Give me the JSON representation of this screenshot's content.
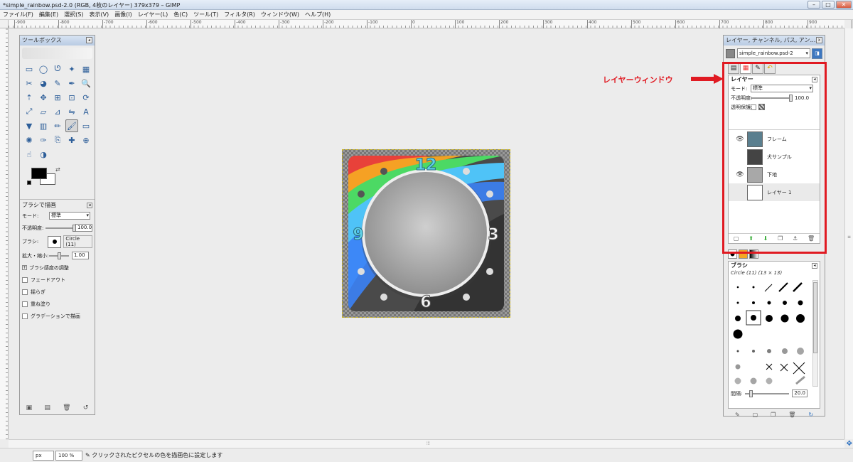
{
  "window": {
    "title": "*simple_rainbow.psd-2.0 (RGB, 4枚のレイヤー) 379x379 – GIMP"
  },
  "menu": [
    "ファイル(F)",
    "編集(E)",
    "選択(S)",
    "表示(V)",
    "画像(I)",
    "レイヤー(L)",
    "色(C)",
    "ツール(T)",
    "フィルタ(R)",
    "ウィンドウ(W)",
    "ヘルプ(H)"
  ],
  "ruler": {
    "ticks": [
      "-900",
      "-800",
      "-700",
      "-600",
      "-500",
      "-400",
      "-300",
      "-200",
      "-100",
      "0",
      "100",
      "200",
      "300",
      "400",
      "500",
      "600",
      "700",
      "800",
      "900",
      "1000"
    ]
  },
  "toolbox": {
    "title": "ツールボックス",
    "tools": [
      "rect-select-icon",
      "ellipse-select-icon",
      "lasso-icon",
      "fuzzy-select-icon",
      "select-by-color-icon",
      "scissors-icon",
      "foreground-select-icon",
      "paths-icon",
      "color-picker-icon",
      "zoom-icon",
      "measure-icon",
      "move-icon",
      "align-icon",
      "crop-icon",
      "rotate-icon",
      "scale-icon",
      "shear-icon",
      "perspective-icon",
      "flip-icon",
      "text-icon",
      "bucket-fill-icon",
      "blend-icon",
      "pencil-icon",
      "paintbrush-icon",
      "eraser-icon",
      "airbrush-icon",
      "ink-icon",
      "clone-icon",
      "heal-icon",
      "perspective-clone-icon",
      "smudge-icon",
      "dodge-burn-icon"
    ],
    "active_tool_index": 23,
    "options": {
      "title": "ブラシで描画",
      "mode_label": "モード:",
      "mode_value": "標準",
      "opacity_label": "不透明度:",
      "opacity_value": "100.0",
      "brush_label": "ブラシ:",
      "brush_value": "Circle (11)",
      "scale_label": "拡大・縮小:",
      "scale_value": "1.00",
      "dynamics_label": "ブラシ感度の調整",
      "fade_label": "フェードアウト",
      "jitter_label": "揺らぎ",
      "incremental_label": "重ね塗り",
      "gradient_label": "グラデーションで描画"
    }
  },
  "canvas": {
    "numerals": [
      "12",
      "3",
      "6",
      "9"
    ]
  },
  "dock": {
    "title": "レイヤー, チャンネル, パス, アン…",
    "image_name": "simple_rainbow.psd-2",
    "layers": {
      "title": "レイヤー",
      "mode_label": "モード:",
      "mode_value": "標準",
      "opacity_label": "不透明度:",
      "opacity_value": "100.0",
      "lock_label": "透明保護:",
      "items": [
        {
          "name": "フレーム",
          "visible": true,
          "thumb": "#5a7f8f"
        },
        {
          "name": "犬サンプル",
          "visible": false,
          "thumb": "#444444"
        },
        {
          "name": "下地",
          "visible": true,
          "thumb": "#a8a8a8"
        },
        {
          "name": "レイヤー 1",
          "visible": false,
          "thumb": "#ffffff"
        }
      ]
    },
    "brushes": {
      "title": "ブラシ",
      "subtitle": "Circle (11) (13 × 13)",
      "spacing_label": "間隔:",
      "spacing_value": "20.0"
    }
  },
  "annotation": {
    "label": "レイヤーウィンドウ",
    "color": "#e01a22"
  },
  "status": {
    "unit": "px",
    "zoom": "100 %",
    "message": "クリックされたピクセルの色を描画色に設定します"
  }
}
